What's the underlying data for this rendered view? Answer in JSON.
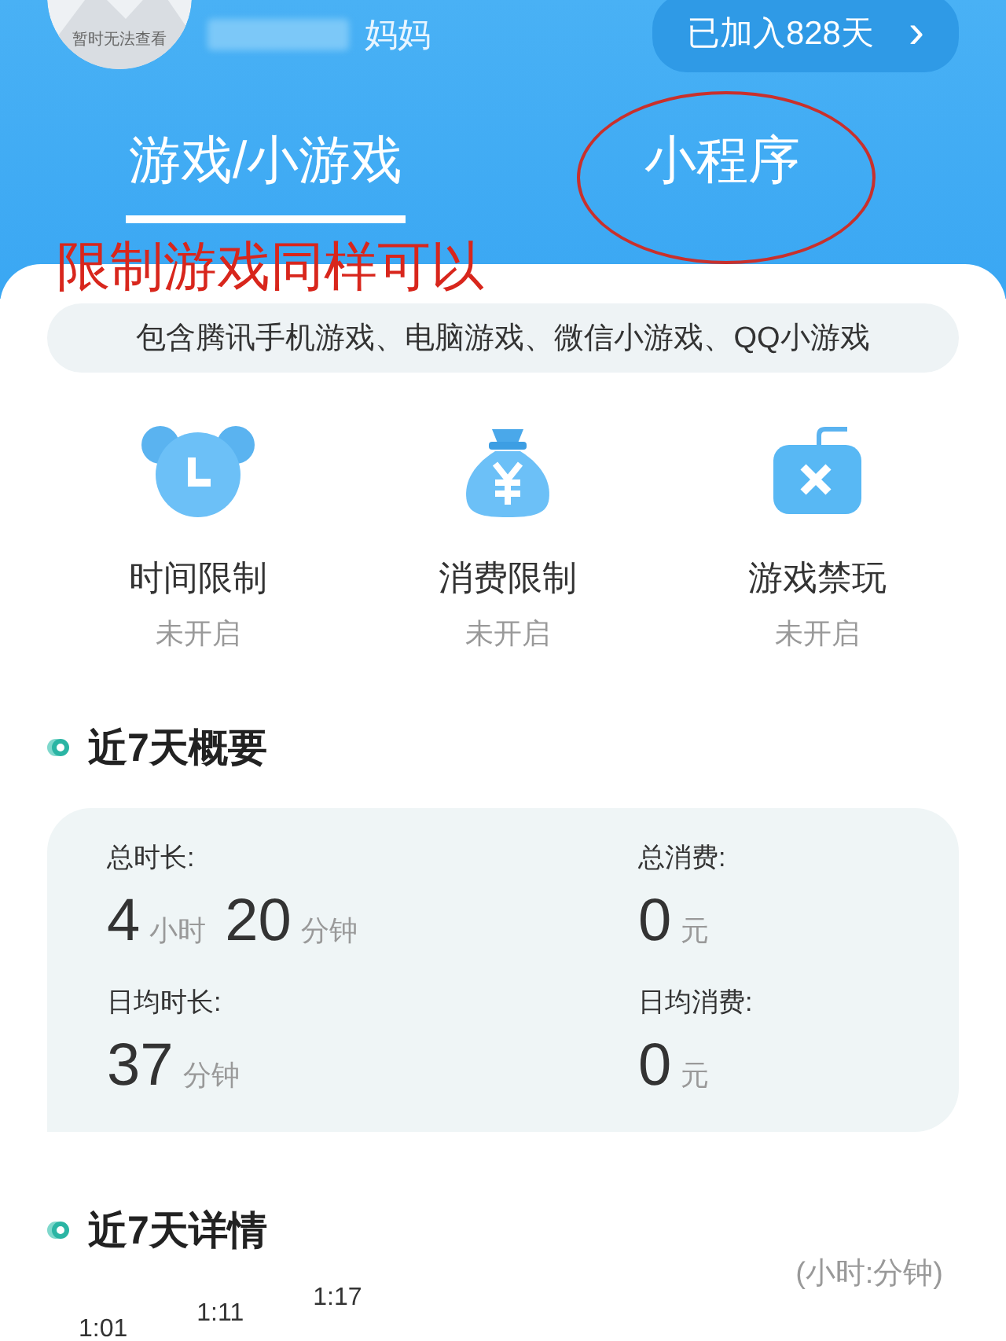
{
  "profile": {
    "avatar_caption": "暂时无法查看",
    "relation": "妈妈",
    "joined": "已加入828天",
    "joined_arrow": "›"
  },
  "tabs": [
    {
      "label": "游戏/小游戏",
      "selected": true,
      "circled": false
    },
    {
      "label": "小程序",
      "selected": false,
      "circled": true
    }
  ],
  "annotation": {
    "text": "限制游戏同样可以"
  },
  "notice": "包含腾讯手机游戏、电脑游戏、微信小游戏、QQ小游戏",
  "controls": [
    {
      "kind": "clock",
      "label": "时间限制",
      "status": "未开启"
    },
    {
      "kind": "money",
      "label": "消费限制",
      "status": "未开启"
    },
    {
      "kind": "block",
      "label": "游戏禁玩",
      "status": "未开启"
    }
  ],
  "summary": {
    "title": "近7天概要",
    "stats": [
      {
        "label": "总时长:",
        "parts": [
          {
            "kind": "num",
            "text": "4"
          },
          {
            "kind": "unit",
            "text": "小时"
          },
          {
            "kind": "num",
            "text": "20"
          },
          {
            "kind": "unit",
            "text": "分钟"
          }
        ]
      },
      {
        "label": "总消费:",
        "parts": [
          {
            "kind": "num",
            "text": "0"
          },
          {
            "kind": "unit",
            "text": "元"
          }
        ]
      },
      {
        "label": "日均时长:",
        "parts": [
          {
            "kind": "num",
            "text": "37"
          },
          {
            "kind": "unit",
            "text": "分钟"
          }
        ]
      },
      {
        "label": "日均消费:",
        "parts": [
          {
            "kind": "num",
            "text": "0"
          },
          {
            "kind": "unit",
            "text": "元"
          }
        ]
      }
    ]
  },
  "details": {
    "title": "近7天详情",
    "unit": "(小时:分钟)",
    "bar_labels": [
      "1:01",
      "1:11",
      "1:17"
    ]
  }
}
